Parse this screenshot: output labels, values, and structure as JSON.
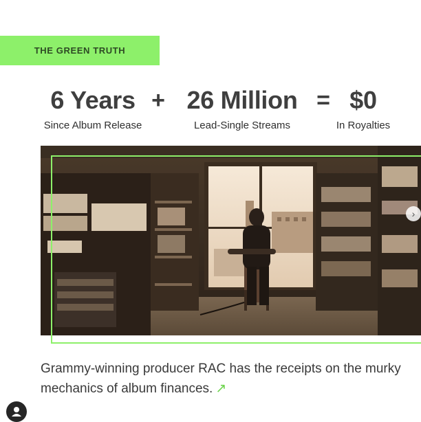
{
  "tag": {
    "label": "THE GREEN TRUTH"
  },
  "stats": [
    {
      "value": "6 Years",
      "caption": "Since Album Release"
    },
    {
      "value": "26 Million",
      "caption": "Lead-Single Streams"
    },
    {
      "value": "$0",
      "caption": "In Royalties"
    }
  ],
  "operators": {
    "plus": "+",
    "equals": "="
  },
  "photo": {
    "next_icon": "chevron-right-icon"
  },
  "caption": {
    "text": "Grammy-winning producer RAC has the receipts on the murky mechanics of album finances.",
    "link_icon": "↗"
  },
  "colors": {
    "accent": "#8df06a",
    "text": "#3d3d3d"
  }
}
